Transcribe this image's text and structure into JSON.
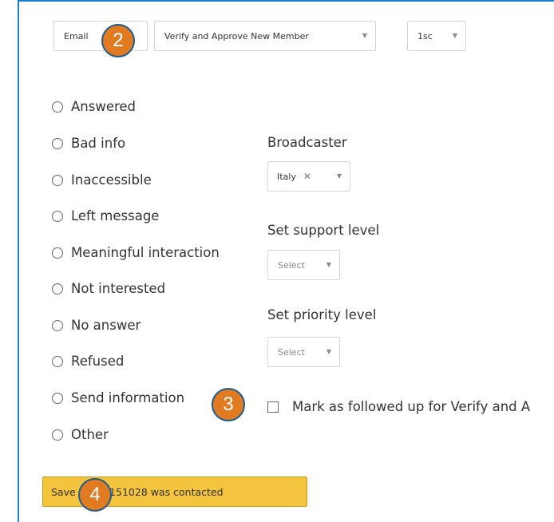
{
  "top_row": {
    "email_label": "Email",
    "script_select": "Verify and Approve New Member",
    "sequence_select": "1sc"
  },
  "responses": [
    "Answered",
    "Bad info",
    "Inaccessible",
    "Left message",
    "Meaningful interaction",
    "Not interested",
    "No answer",
    "Refused",
    "Send information",
    "Other"
  ],
  "broadcaster": {
    "label": "Broadcaster",
    "tag": "Italy"
  },
  "support": {
    "label": "Set support level",
    "select": "Select"
  },
  "priority": {
    "label": "Set priority level",
    "select": "Select"
  },
  "followup": {
    "label": "Mark as followed up for Verify and A"
  },
  "save_button": {
    "label": "Save join20151028 was contacted"
  },
  "badges": [
    "2",
    "3",
    "4"
  ],
  "colors": {
    "badge": "#e07b22",
    "badge_border": "#1d5d8f",
    "button": "#f4c43f",
    "frame": "#1e7fd0"
  }
}
